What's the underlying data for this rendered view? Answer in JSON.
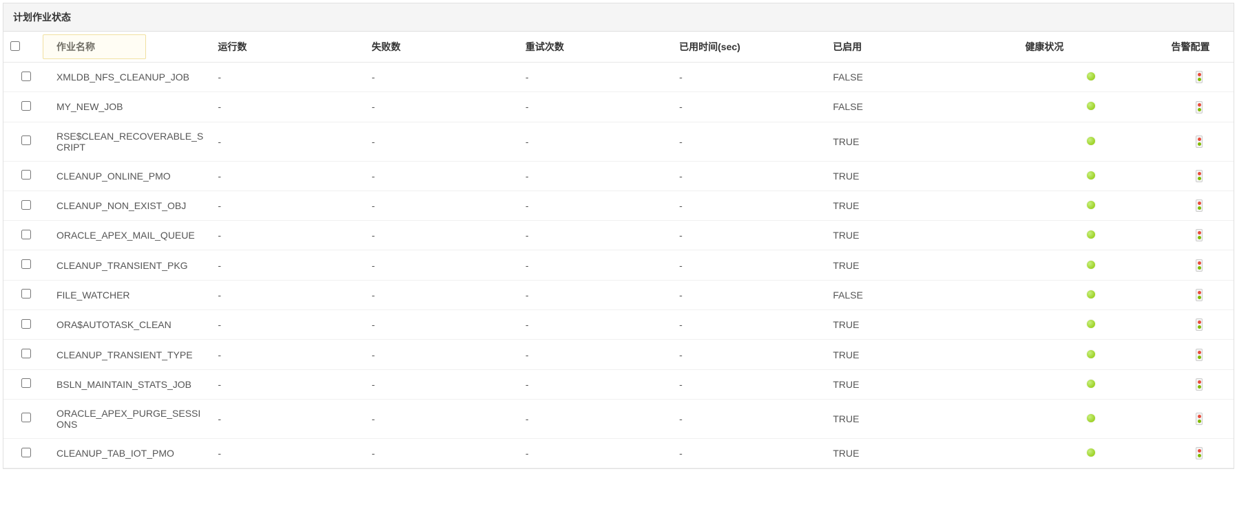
{
  "panel": {
    "title": "计划作业状态"
  },
  "columns": {
    "name": "作业名称",
    "run": "运行数",
    "fail": "失败数",
    "retry": "重试次数",
    "time": "已用时间(sec)",
    "enabled": "已启用",
    "health": "健康状况",
    "alarm": "告警配置"
  },
  "rows": [
    {
      "name": "XMLDB_NFS_CLEANUP_JOB",
      "run": "-",
      "fail": "-",
      "retry": "-",
      "time": "-",
      "enabled": "FALSE"
    },
    {
      "name": "MY_NEW_JOB",
      "run": "-",
      "fail": "-",
      "retry": "-",
      "time": "-",
      "enabled": "FALSE"
    },
    {
      "name": "RSE$CLEAN_RECOVERABLE_SCRIPT",
      "run": "-",
      "fail": "-",
      "retry": "-",
      "time": "-",
      "enabled": "TRUE"
    },
    {
      "name": "CLEANUP_ONLINE_PMO",
      "run": "-",
      "fail": "-",
      "retry": "-",
      "time": "-",
      "enabled": "TRUE"
    },
    {
      "name": "CLEANUP_NON_EXIST_OBJ",
      "run": "-",
      "fail": "-",
      "retry": "-",
      "time": "-",
      "enabled": "TRUE"
    },
    {
      "name": "ORACLE_APEX_MAIL_QUEUE",
      "run": "-",
      "fail": "-",
      "retry": "-",
      "time": "-",
      "enabled": "TRUE"
    },
    {
      "name": "CLEANUP_TRANSIENT_PKG",
      "run": "-",
      "fail": "-",
      "retry": "-",
      "time": "-",
      "enabled": "TRUE"
    },
    {
      "name": "FILE_WATCHER",
      "run": "-",
      "fail": "-",
      "retry": "-",
      "time": "-",
      "enabled": "FALSE"
    },
    {
      "name": "ORA$AUTOTASK_CLEAN",
      "run": "-",
      "fail": "-",
      "retry": "-",
      "time": "-",
      "enabled": "TRUE"
    },
    {
      "name": "CLEANUP_TRANSIENT_TYPE",
      "run": "-",
      "fail": "-",
      "retry": "-",
      "time": "-",
      "enabled": "TRUE"
    },
    {
      "name": "BSLN_MAINTAIN_STATS_JOB",
      "run": "-",
      "fail": "-",
      "retry": "-",
      "time": "-",
      "enabled": "TRUE"
    },
    {
      "name": "ORACLE_APEX_PURGE_SESSIONS",
      "run": "-",
      "fail": "-",
      "retry": "-",
      "time": "-",
      "enabled": "TRUE"
    },
    {
      "name": "CLEANUP_TAB_IOT_PMO",
      "run": "-",
      "fail": "-",
      "retry": "-",
      "time": "-",
      "enabled": "TRUE"
    }
  ]
}
